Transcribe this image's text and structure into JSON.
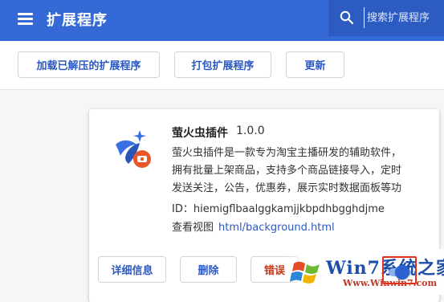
{
  "header": {
    "title": "扩展程序",
    "search_placeholder": "搜索扩展程序",
    "color": "#3469d6"
  },
  "toolbar": {
    "load_unpacked": "加载已解压的扩展程序",
    "pack": "打包扩展程序",
    "update": "更新"
  },
  "extension": {
    "name": "萤火虫插件",
    "version": "1.0.0",
    "description_lines": [
      "萤火虫插件是一款专为淘宝主播研发的辅助软件，",
      "拥有批量上架商品，支持多个商品链接导入，定时",
      "发送关注，公告，优惠券，展示实时数据面板等功"
    ],
    "id_text": "ID：hiemigflbaalggkamjjkbpdhbgghdjme",
    "views_label": "查看视图",
    "views_link": "html/background.html",
    "details_button": "详细信息",
    "remove_button": "删除",
    "errors_button": "错误",
    "enabled": true,
    "icon": "firefly-icon"
  },
  "watermark": {
    "title": "Win7系统之家",
    "url": "Www.Winwin7.com"
  }
}
